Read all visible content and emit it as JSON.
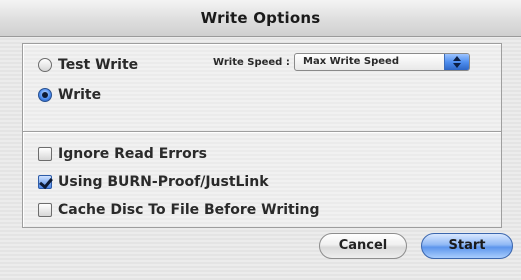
{
  "window": {
    "title": "Write Options"
  },
  "mode": {
    "options": [
      {
        "label": "Test Write",
        "selected": false
      },
      {
        "label": "Write",
        "selected": true
      }
    ]
  },
  "speed": {
    "label": "Write Speed :",
    "value": "Max Write Speed"
  },
  "options": {
    "items": [
      {
        "label": "Ignore Read Errors",
        "checked": false
      },
      {
        "label": "Using BURN-Proof/JustLink",
        "checked": true
      },
      {
        "label": "Cache Disc To File Before Writing",
        "checked": false
      }
    ]
  },
  "buttons": {
    "cancel": "Cancel",
    "start": "Start"
  },
  "colors": {
    "accent": "#4c8df0"
  }
}
